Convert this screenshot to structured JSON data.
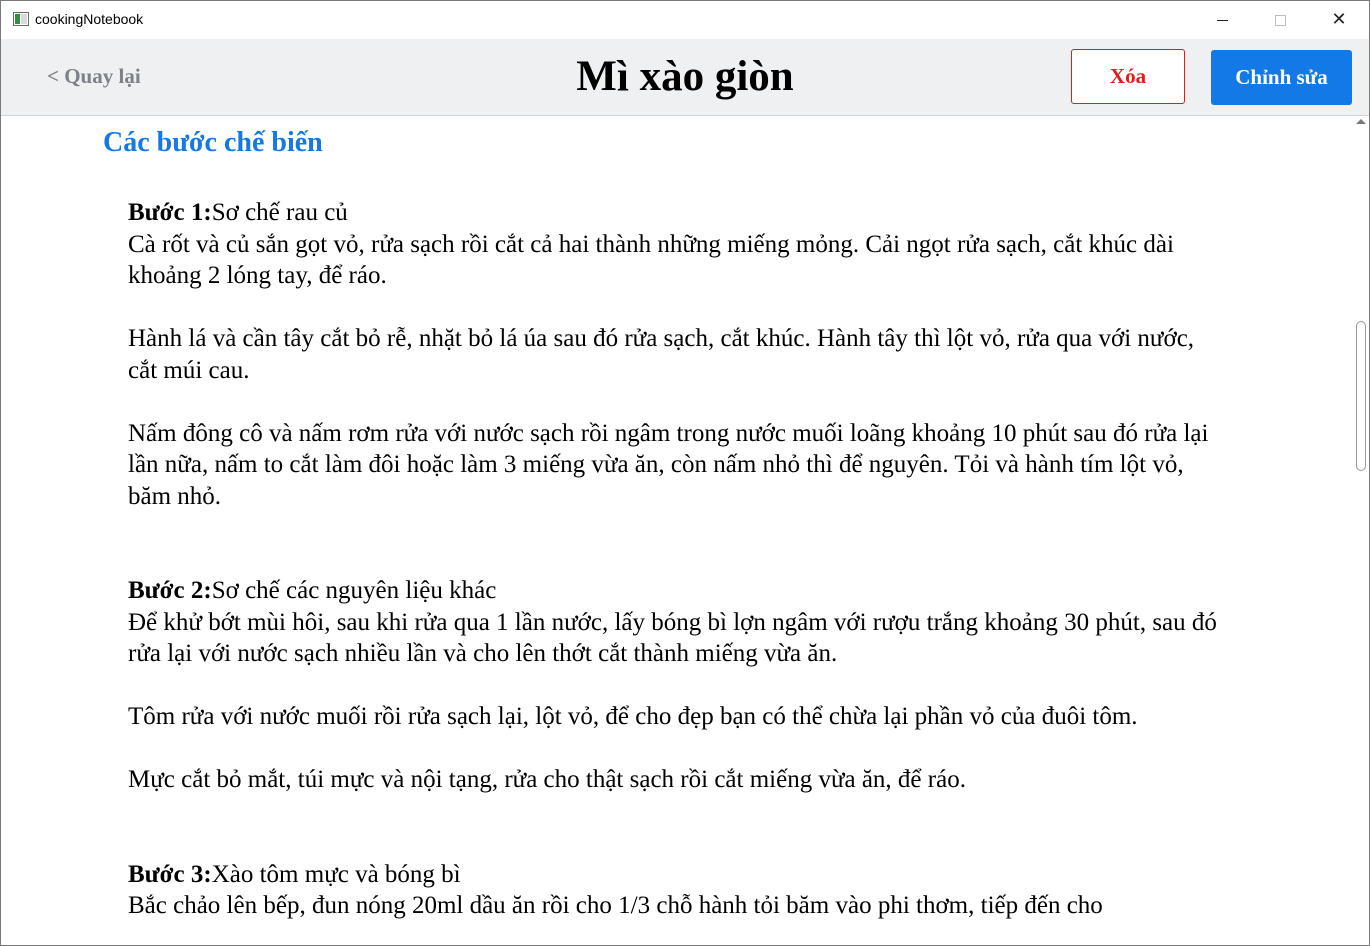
{
  "window": {
    "title": "cookingNotebook",
    "controls": {
      "minimize": "",
      "maximize": "",
      "close": "✕"
    }
  },
  "header": {
    "back_label": "< Quay lại",
    "title": "Mì xào giòn",
    "delete_label": "Xóa",
    "edit_label": "Chỉnh sửa"
  },
  "colors": {
    "accent": "#1379e6",
    "danger": "#e41b1b",
    "header_bg": "#eef0f2",
    "back_text": "#7d8288"
  },
  "content": {
    "section_title": "Các bước chế biến",
    "steps": [
      {
        "label": "Bước 1:",
        "name": "Sơ chế rau củ",
        "paragraphs": [
          "Cà rốt và củ sắn gọt vỏ, rửa sạch rồi cắt cả hai thành những miếng mỏng. Cải ngọt rửa sạch, cắt khúc dài khoảng 2 lóng tay, để ráo.",
          "Hành lá và cần tây cắt bỏ rễ, nhặt bỏ lá úa sau đó rửa sạch, cắt khúc. Hành tây thì lột vỏ, rửa qua với nước, cắt múi cau.",
          "Nấm đông cô và nấm rơm rửa với nước sạch rồi ngâm trong nước muối loãng khoảng 10 phút sau đó rửa lại lần nữa, nấm to cắt làm đôi hoặc làm 3 miếng vừa ăn, còn nấm nhỏ thì để nguyên. Tỏi và hành tím lột vỏ, băm nhỏ."
        ]
      },
      {
        "label": "Bước 2:",
        "name": "Sơ chế các nguyên liệu khác",
        "paragraphs": [
          "Để khử bớt mùi hôi, sau khi rửa qua 1 lần nước, lấy bóng bì lợn ngâm với rượu trắng khoảng 30 phút, sau đó rửa lại với nước sạch nhiều lần và cho lên thớt cắt thành miếng vừa ăn.",
          "Tôm rửa với nước muối rồi rửa sạch lại, lột vỏ, để cho đẹp bạn có thể chừa lại phần vỏ của đuôi tôm.",
          "Mực cắt bỏ mắt, túi mực và nội tạng, rửa cho thật sạch rồi cắt miếng vừa ăn, để ráo."
        ]
      },
      {
        "label": "Bước 3:",
        "name": "Xào tôm mực và bóng bì",
        "paragraphs": [
          "Bắc chảo lên bếp, đun nóng 20ml dầu ăn rồi cho 1/3 chỗ hành tỏi băm vào phi thơm, tiếp đến cho"
        ]
      }
    ]
  }
}
